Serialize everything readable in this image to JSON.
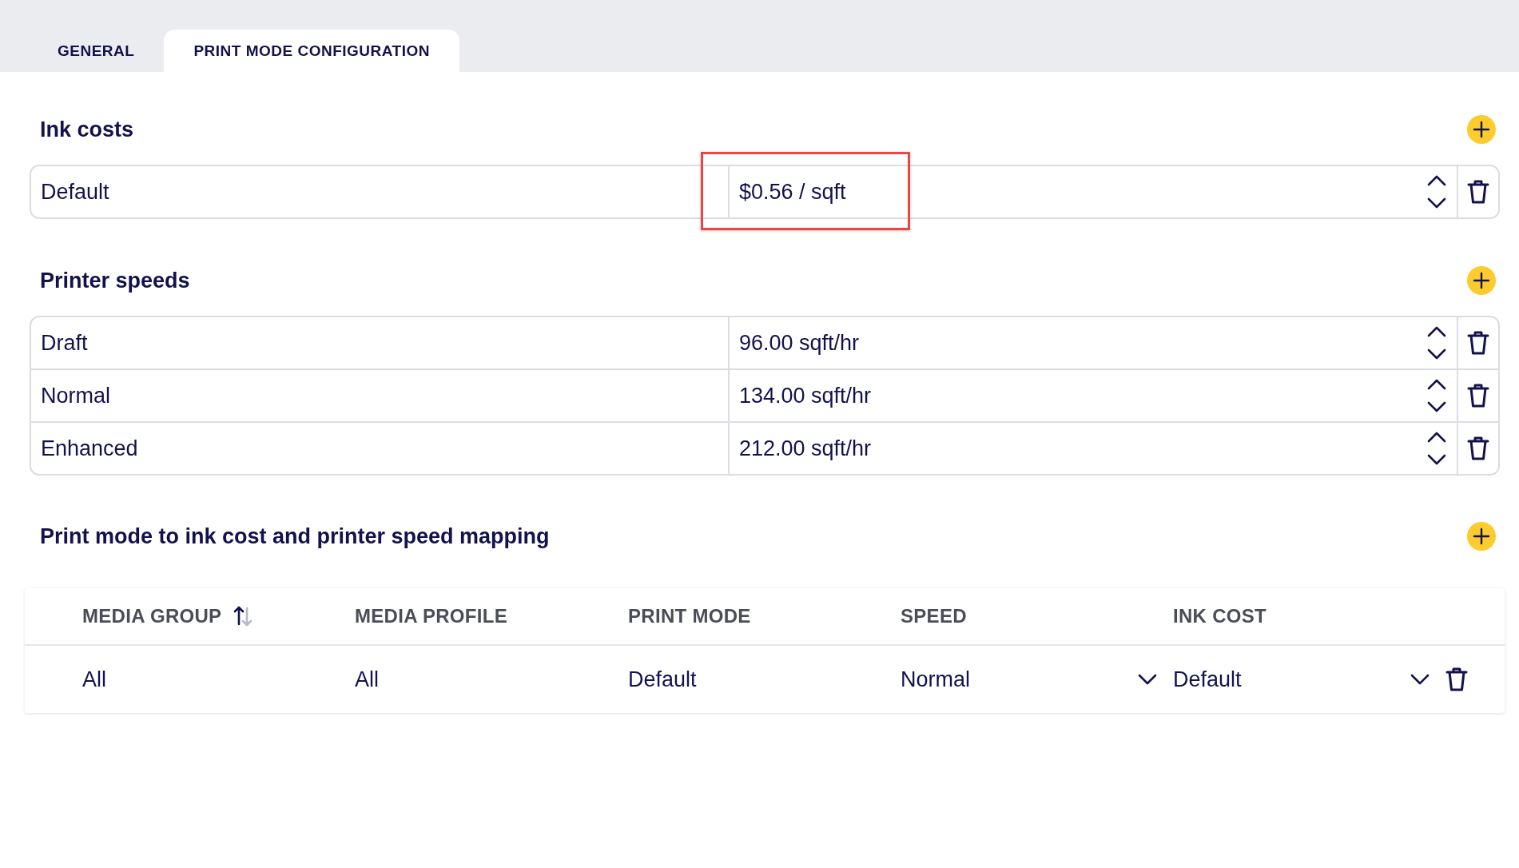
{
  "tabs": [
    {
      "label": "GENERAL",
      "selected": false
    },
    {
      "label": "PRINT MODE CONFIGURATION",
      "selected": true
    }
  ],
  "ink_costs": {
    "title": "Ink costs",
    "items": [
      {
        "name": "Default",
        "value": "$0.56 / sqft",
        "highlighted": true
      }
    ]
  },
  "printer_speeds": {
    "title": "Printer speeds",
    "items": [
      {
        "name": "Draft",
        "value": "96.00 sqft/hr"
      },
      {
        "name": "Normal",
        "value": "134.00 sqft/hr"
      },
      {
        "name": "Enhanced",
        "value": "212.00 sqft/hr"
      }
    ]
  },
  "mapping": {
    "title": "Print mode to ink cost and printer speed mapping",
    "columns": [
      {
        "label": "MEDIA GROUP",
        "sorted_ascending": true
      },
      {
        "label": "MEDIA PROFILE"
      },
      {
        "label": "PRINT MODE"
      },
      {
        "label": "SPEED"
      },
      {
        "label": "INK COST"
      }
    ],
    "rows": [
      {
        "cells": [
          {
            "kind": "text",
            "value": "All"
          },
          {
            "kind": "text",
            "value": "All"
          },
          {
            "kind": "text",
            "value": "Default"
          },
          {
            "kind": "dropdown",
            "value": "Normal"
          },
          {
            "kind": "dropdown",
            "value": "Default"
          }
        ]
      }
    ]
  }
}
